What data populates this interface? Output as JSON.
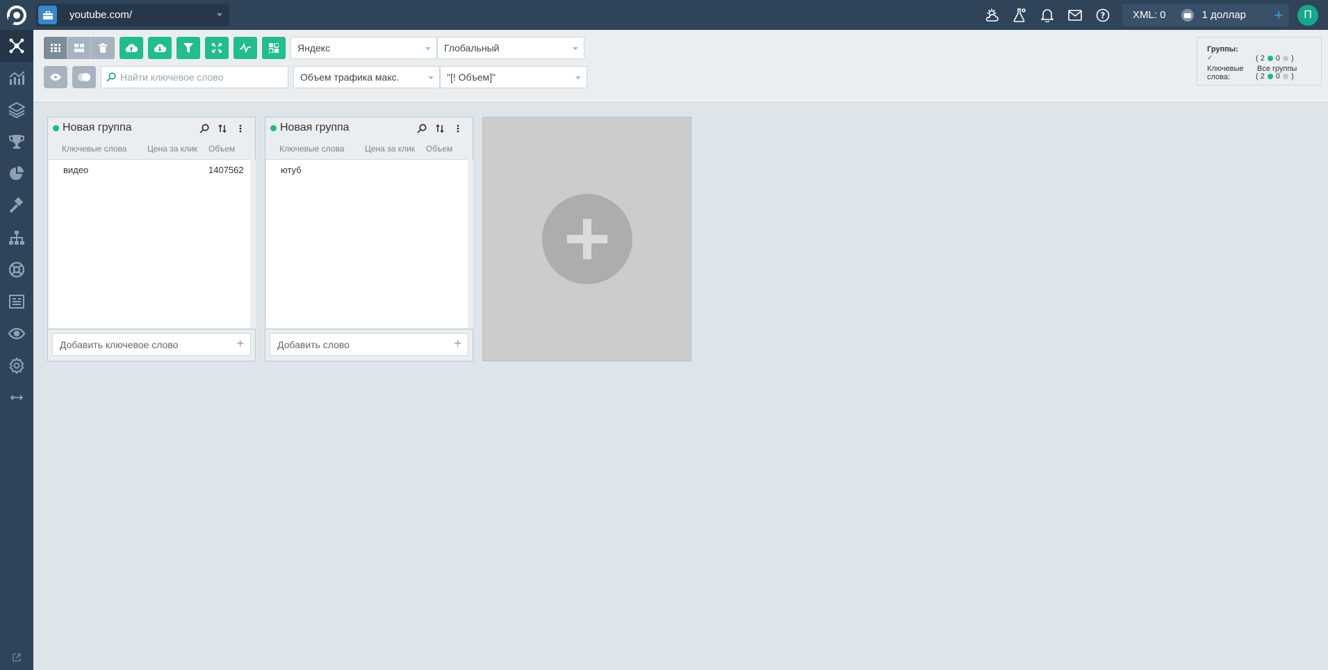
{
  "project": {
    "name": "youtube.com/"
  },
  "header": {
    "xml_label": "XML: 0",
    "balance": "1 доллар",
    "add": "+",
    "avatar_letter": "П"
  },
  "toolbar": {
    "search_placeholder": "Найти ключевое слово",
    "engine": "Яндекс",
    "region": "Глобальный",
    "sort_by": "Объем трафика макс.",
    "match_type": "\"[! Объем]\""
  },
  "stats": {
    "groups_label": "Группы:",
    "groups_counts": [
      "2",
      "0"
    ],
    "keywords_label": "Ключевые слова:",
    "keywords_counts": [
      "2",
      "0"
    ],
    "all_groups": "Все группы"
  },
  "columns": {
    "keywords": "Ключевые слова",
    "cpc": "Цена за клик",
    "volume": "Объем"
  },
  "groups": [
    {
      "title": "Новая группа",
      "keywords": [
        {
          "word": "видео",
          "cpc": "",
          "volume": "1407562"
        }
      ],
      "add_placeholder": "Добавить ключевое слово"
    },
    {
      "title": "Новая группа",
      "keywords": [
        {
          "word": "ютуб",
          "cpc": "",
          "volume": ""
        }
      ],
      "add_placeholder": "Добавить слово"
    }
  ],
  "add_plus": "+"
}
